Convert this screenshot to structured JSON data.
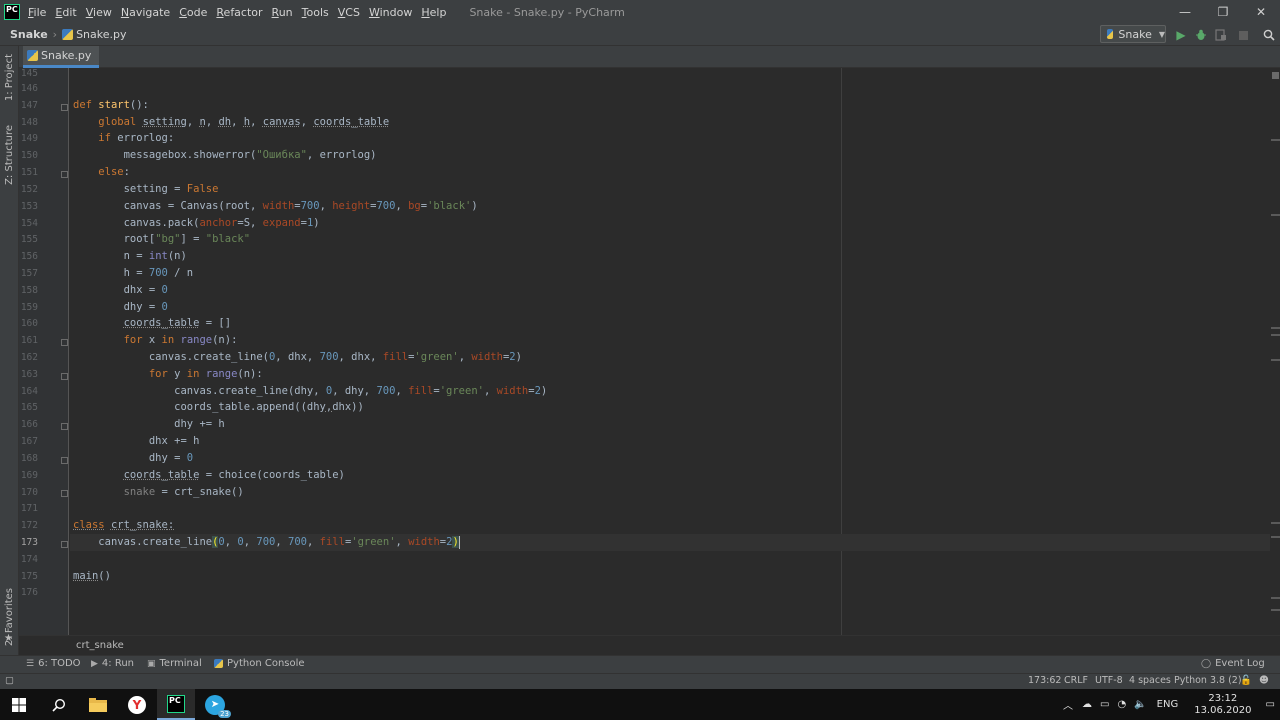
{
  "window": {
    "logo": "PC",
    "title": "Snake - Snake.py - PyCharm",
    "menu": [
      "File",
      "Edit",
      "View",
      "Navigate",
      "Code",
      "Refactor",
      "Run",
      "Tools",
      "VCS",
      "Window",
      "Help"
    ],
    "controls": {
      "minimize": "—",
      "maximize": "❐",
      "close": "✕"
    }
  },
  "navbar": {
    "project": "Snake",
    "file": "Snake.py",
    "run_config": "Snake"
  },
  "left_strip": {
    "tabs": [
      "1: Project",
      "Z: Structure",
      "2: Favorites"
    ]
  },
  "editor": {
    "tab_label": "Snake.py",
    "current_line": 173,
    "line_numbers": [
      "145",
      "146",
      "147",
      "148",
      "149",
      "150",
      "151",
      "152",
      "153",
      "154",
      "155",
      "156",
      "157",
      "158",
      "159",
      "160",
      "161",
      "162",
      "163",
      "164",
      "165",
      "166",
      "167",
      "168",
      "169",
      "170",
      "171",
      "172",
      "173",
      "174",
      "175",
      "176"
    ]
  },
  "code": {
    "l147": [
      "def",
      "start",
      "():"
    ],
    "l148": [
      "global",
      "setting",
      "n",
      "dh",
      "h",
      "canvas",
      "coords_table"
    ],
    "l149": [
      "if",
      "errorlog:"
    ],
    "l150": [
      "messagebox.showerror(",
      "\"Ошибка\"",
      ", errorlog)"
    ],
    "l151": [
      "else",
      ":"
    ],
    "l152": [
      "setting = ",
      "False"
    ],
    "l153": [
      "canvas = Canvas(root, ",
      "width",
      "=",
      "700",
      ", ",
      "height",
      "=",
      "700",
      ", ",
      "bg",
      "=",
      "'black'",
      ")"
    ],
    "l154": [
      "canvas.pack(",
      "anchor",
      "=S, ",
      "expand",
      "=",
      "1",
      ")"
    ],
    "l155": [
      "root[",
      "\"bg\"",
      "] = ",
      "\"black\""
    ],
    "l156": [
      "n = ",
      "int",
      "(n)"
    ],
    "l157": [
      "h = ",
      "700",
      " / n"
    ],
    "l158": [
      "dhx = ",
      "0"
    ],
    "l159": [
      "dhy = ",
      "0"
    ],
    "l160": [
      "coords_table",
      " = []"
    ],
    "l161": [
      "for",
      " x ",
      "in",
      " ",
      "range",
      "(n):"
    ],
    "l162": [
      "canvas.create_line(",
      "0",
      ", dhx, ",
      "700",
      ", dhx, ",
      "fill",
      "=",
      "'green'",
      ", ",
      "width",
      "=",
      "2",
      ")"
    ],
    "l163": [
      "for",
      " y ",
      "in",
      " ",
      "range",
      "(n):"
    ],
    "l164": [
      "canvas.create_line(dhy, ",
      "0",
      ", dhy, ",
      "700",
      ", ",
      "fill",
      "=",
      "'green'",
      ", ",
      "width",
      "=",
      "2",
      ")"
    ],
    "l165": [
      "coords_table.append((dhy",
      ",",
      "dhx))"
    ],
    "l166": [
      "dhy += h"
    ],
    "l167": [
      "dhx += h"
    ],
    "l168": [
      "dhy = ",
      "0"
    ],
    "l169": [
      "coords_table",
      " = choice(coords_table)"
    ],
    "l170": [
      "snake",
      " = crt_snake()"
    ],
    "l172": [
      "class",
      " ",
      "crt_snake",
      ":"
    ],
    "l173": [
      "canvas.create_line",
      "(",
      "0",
      ", ",
      "0",
      ", ",
      "700",
      ", ",
      "700",
      ", ",
      "fill",
      "=",
      "'green'",
      ", ",
      "width",
      "=",
      "2",
      ")"
    ],
    "l175": [
      "main",
      "()"
    ]
  },
  "breadcrumb": "crt_snake",
  "tool_windows": [
    "6: TODO",
    "4: Run",
    "Terminal",
    "Python Console",
    "Event Log"
  ],
  "status": {
    "position": "173:62",
    "line_sep": "CRLF",
    "encoding": "UTF-8",
    "indent": "4 spaces",
    "interpreter": "Python 3.8 (2)"
  },
  "taskbar": {
    "language": "ENG",
    "time": "23:12",
    "date": "13.06.2020",
    "telegram_badge": "23"
  },
  "colors": {
    "keyword": "#cc7832",
    "function": "#ffc66d",
    "string": "#6a8759",
    "number": "#6897bb",
    "param": "#aa4926",
    "builtin": "#8888c6"
  }
}
